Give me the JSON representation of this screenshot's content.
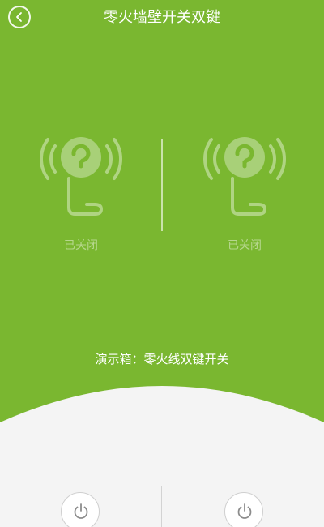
{
  "header": {
    "title": "零火墙壁开关双键",
    "back_icon": "chevron-left-icon"
  },
  "devices": [
    {
      "id": "left",
      "status": "已关闭",
      "icon": "socket-signal-icon"
    },
    {
      "id": "right",
      "status": "已关闭",
      "icon": "socket-signal-icon"
    }
  ],
  "caption": "演示箱：零火线双键开关",
  "controls": [
    {
      "id": "left",
      "icon": "power-icon"
    },
    {
      "id": "right",
      "icon": "power-icon"
    }
  ],
  "colors": {
    "background": "#7ab730",
    "panel": "#f4f4f4",
    "text": "#ffffff"
  }
}
